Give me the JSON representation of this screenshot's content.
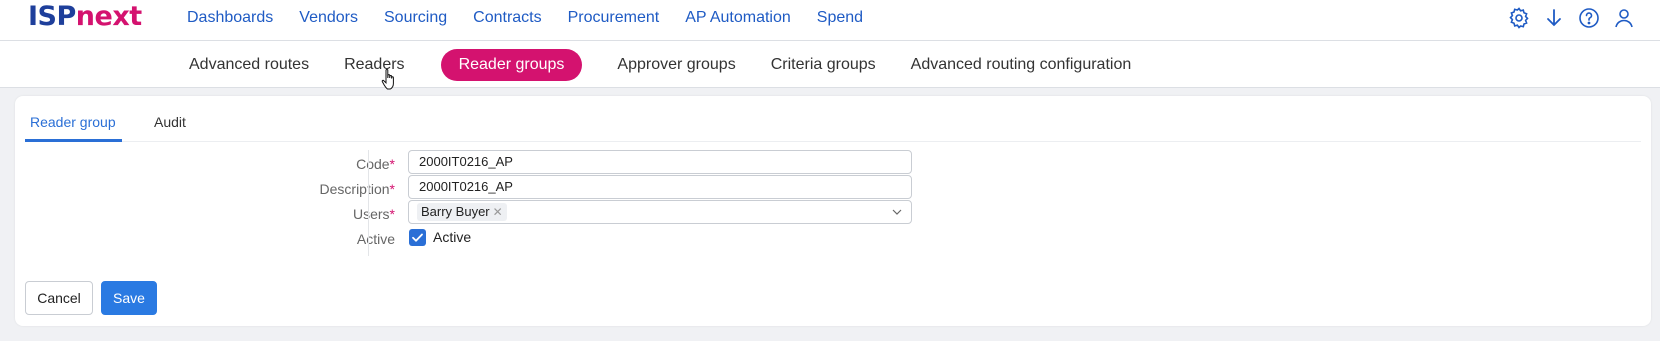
{
  "brand": {
    "part1": "ISP",
    "part2": "next"
  },
  "main_nav": [
    "Dashboards",
    "Vendors",
    "Sourcing",
    "Contracts",
    "Procurement",
    "AP Automation",
    "Spend"
  ],
  "top_icons": [
    "gear-icon",
    "download-icon",
    "help-icon",
    "user-icon"
  ],
  "sub_nav": {
    "items": [
      "Advanced routes",
      "Readers",
      "Reader groups",
      "Approver groups",
      "Criteria groups",
      "Advanced routing configuration"
    ],
    "active": "Reader groups"
  },
  "tabs": {
    "reader_group": "Reader group",
    "audit": "Audit",
    "active": "Reader group"
  },
  "form": {
    "code": {
      "label": "Code",
      "required_mark": "*",
      "value": "2000IT0216_AP"
    },
    "description": {
      "label": "Description",
      "required_mark": "*",
      "value": "2000IT0216_AP"
    },
    "users": {
      "label": "Users",
      "required_mark": "*",
      "selected": "Barry Buyer",
      "remove_glyph": "✕"
    },
    "active": {
      "label": "Active",
      "checkbox_label": "Active",
      "checked": true
    }
  },
  "buttons": {
    "cancel": "Cancel",
    "save": "Save"
  },
  "colors": {
    "brand_blue": "#1e3f9b",
    "brand_pink": "#d4126f",
    "link_blue": "#1f5bc4",
    "primary": "#2a7ae2"
  }
}
